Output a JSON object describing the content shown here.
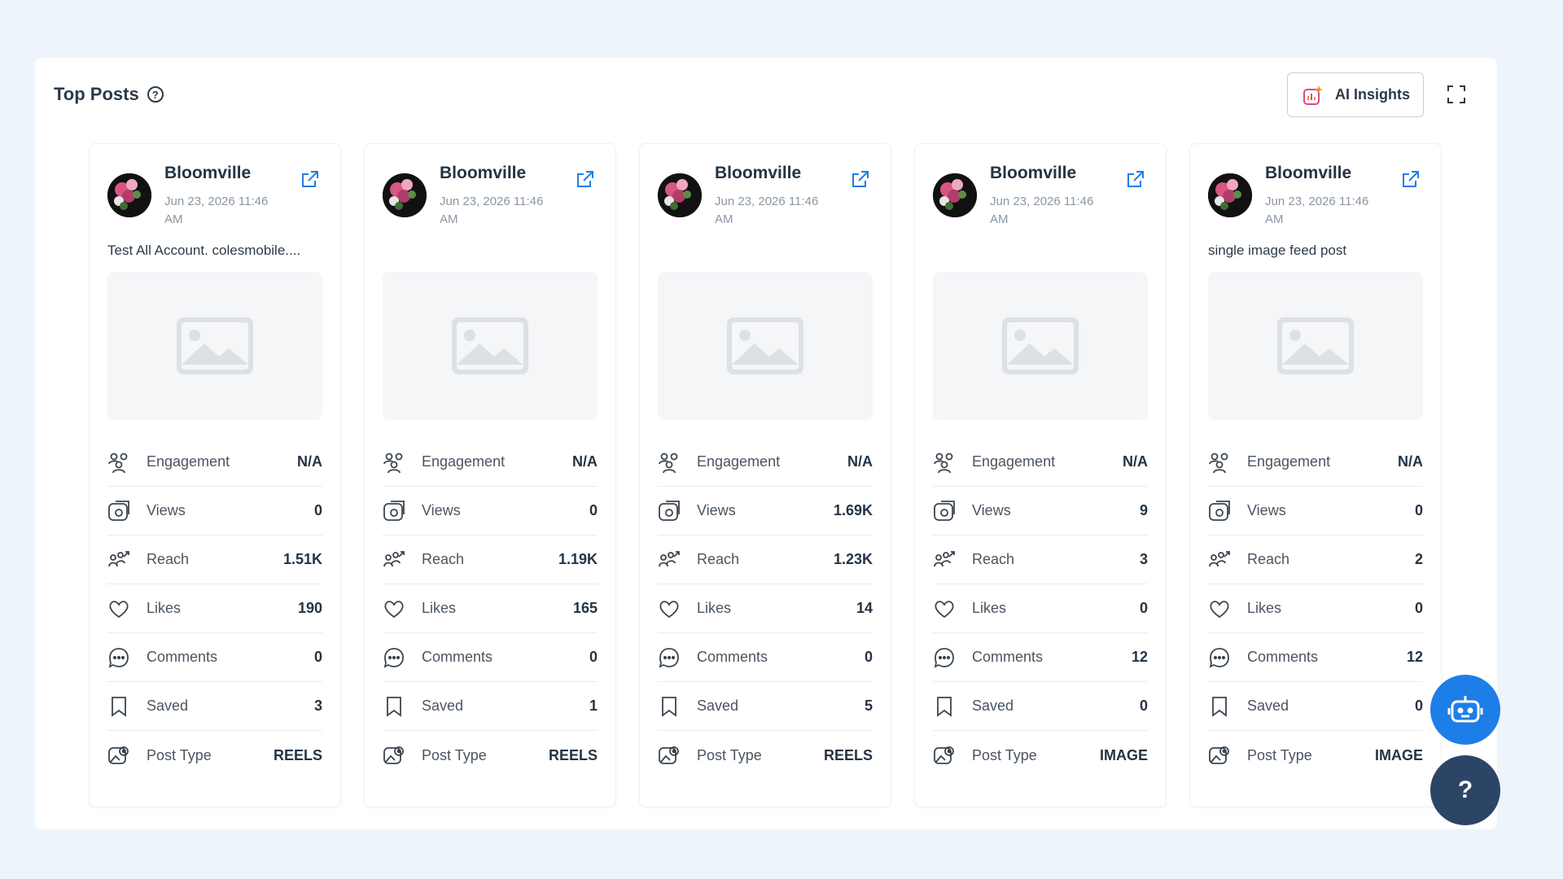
{
  "header": {
    "title": "Top Posts",
    "help_icon": "question-circle-icon",
    "ai_insights_label": "AI Insights",
    "expand_icon": "fullscreen-icon"
  },
  "metric_labels": {
    "engagement": "Engagement",
    "views": "Views",
    "reach": "Reach",
    "likes": "Likes",
    "comments": "Comments",
    "saved": "Saved",
    "post_type": "Post Type"
  },
  "posts": [
    {
      "account": "Bloomville",
      "date": "Jun 23, 2026 11:46 AM",
      "caption": "Test All Account. colesmobile....",
      "engagement": "N/A",
      "views": "0",
      "reach": "1.51K",
      "likes": "190",
      "comments": "0",
      "saved": "3",
      "post_type": "REELS"
    },
    {
      "account": "Bloomville",
      "date": "Jun 23, 2026 11:46 AM",
      "caption": "",
      "engagement": "N/A",
      "views": "0",
      "reach": "1.19K",
      "likes": "165",
      "comments": "0",
      "saved": "1",
      "post_type": "REELS"
    },
    {
      "account": "Bloomville",
      "date": "Jun 23, 2026 11:46 AM",
      "caption": "",
      "engagement": "N/A",
      "views": "1.69K",
      "reach": "1.23K",
      "likes": "14",
      "comments": "0",
      "saved": "5",
      "post_type": "REELS"
    },
    {
      "account": "Bloomville",
      "date": "Jun 23, 2026 11:46 AM",
      "caption": "",
      "engagement": "N/A",
      "views": "9",
      "reach": "3",
      "likes": "0",
      "comments": "12",
      "saved": "0",
      "post_type": "IMAGE"
    },
    {
      "account": "Bloomville",
      "date": "Jun 23, 2026 11:46 AM",
      "caption": "single image feed post",
      "engagement": "N/A",
      "views": "0",
      "reach": "2",
      "likes": "0",
      "comments": "12",
      "saved": "0",
      "post_type": "IMAGE"
    }
  ],
  "fab": {
    "bot_icon": "chatbot-icon",
    "help_label": "?"
  },
  "colors": {
    "accent": "#1e7ee8",
    "help_fab": "#2c4566",
    "background": "#eef4fb"
  }
}
